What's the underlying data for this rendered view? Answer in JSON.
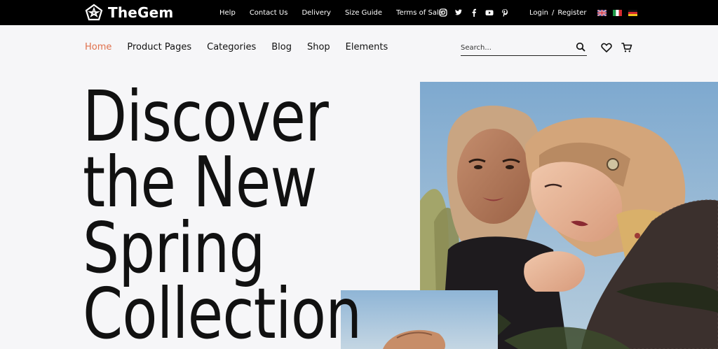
{
  "brand": {
    "name": "TheGem",
    "logo_icon": "pentagon-star-logo"
  },
  "top_links": [
    "Help",
    "Contact Us",
    "Delivery",
    "Size Guide",
    "Terms of Sale"
  ],
  "socials": [
    "instagram-icon",
    "twitter-icon",
    "facebook-icon",
    "youtube-icon",
    "pinterest-icon"
  ],
  "auth": {
    "login": "Login",
    "separator": "/",
    "register": "Register"
  },
  "flags": [
    "uk-flag",
    "italy-flag",
    "germany-flag"
  ],
  "nav": {
    "items": [
      "Home",
      "Product Pages",
      "Categories",
      "Blog",
      "Shop",
      "Elements"
    ],
    "active": "Home"
  },
  "search": {
    "placeholder": "Search..."
  },
  "hero": {
    "line1": "Discover",
    "line2": "the New",
    "line3": "Spring",
    "line4": "Collection"
  },
  "colors": {
    "accent": "#e0704c",
    "topbar": "#000000",
    "background": "#f6f6f8"
  }
}
